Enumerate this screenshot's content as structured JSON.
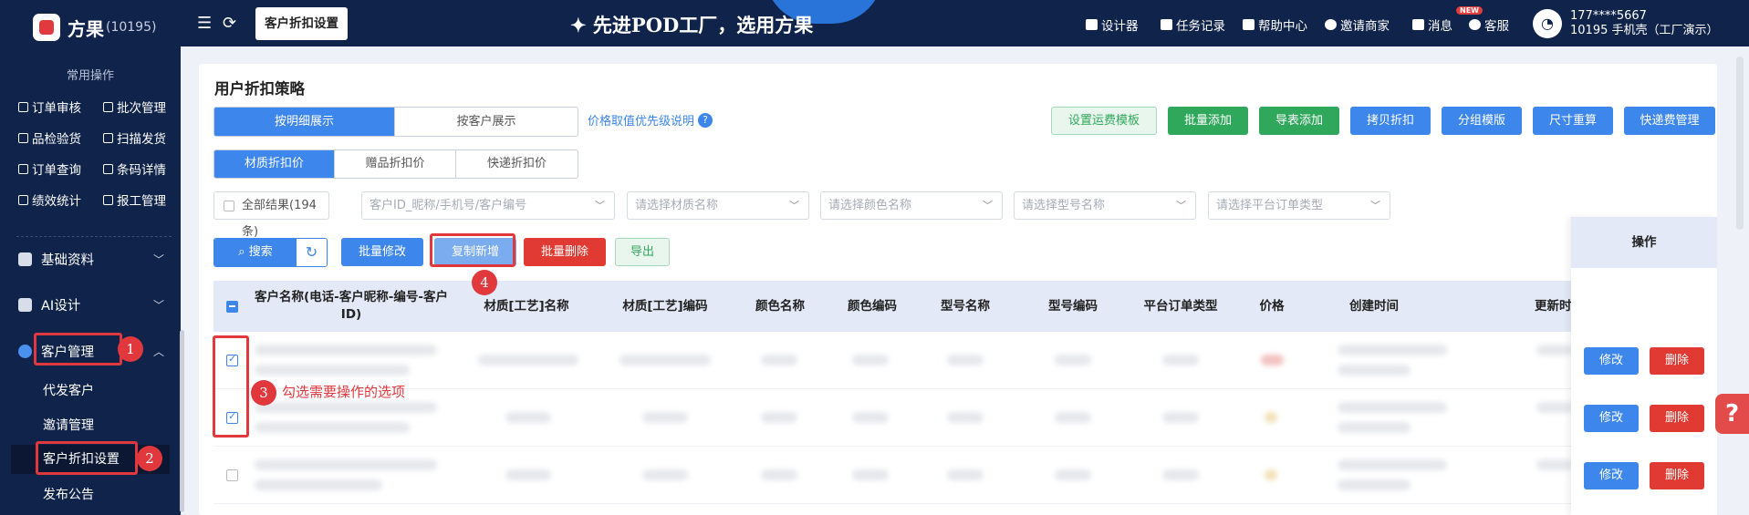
{
  "app": {
    "logo_name": "方果",
    "logo_id": "(10195)"
  },
  "sidebar": {
    "common_title": "常用操作",
    "quick": [
      "订单审核",
      "批次管理",
      "品检验货",
      "扫描发货",
      "订单查询",
      "条码详情",
      "绩效统计",
      "报工管理"
    ],
    "menus": [
      "基础资料",
      "AI设计",
      "客户管理"
    ],
    "subs": [
      "代发客户",
      "邀请管理",
      "客户折扣设置",
      "发布公告"
    ]
  },
  "topbar": {
    "active_tab": "客户折扣设置",
    "slogan": "先进POD工厂，选用方果",
    "links": [
      "设计器",
      "任务记录",
      "帮助中心",
      "邀请商家",
      "消息",
      "客服"
    ],
    "new_badge": "NEW",
    "user_phone": "177****5667",
    "user_org": "10195 手机壳（工厂演示）"
  },
  "page": {
    "title": "用户折扣策略",
    "view_tabs": [
      "按明细展示",
      "按客户展示"
    ],
    "help_link": "价格取值优先级说明",
    "help_q": "?",
    "right_buttons": [
      "设置运费模板",
      "批量添加",
      "导表添加",
      "拷贝折扣",
      "分组模版",
      "尺寸重算",
      "快递费管理"
    ],
    "type_tabs": [
      "材质折扣价",
      "赠品折扣价",
      "快递折扣价"
    ],
    "all_results": "全部结果(194条)",
    "filters": [
      "客户ID_昵称/手机号/客户编号",
      "请选择材质名称",
      "请选择颜色名称",
      "请选择型号名称",
      "请选择平台订单类型"
    ],
    "search": "搜索",
    "actions": [
      "批量修改",
      "复制新增",
      "批量删除",
      "导出"
    ]
  },
  "table": {
    "headers": [
      "客户名称(电话-客户昵称-编号-客户ID)",
      "材质[工艺]名称",
      "材质[工艺]编码",
      "颜色名称",
      "颜色编码",
      "型号名称",
      "型号编码",
      "平台订单类型",
      "价格",
      "创建时间",
      "更新时"
    ],
    "op_header": "操作",
    "edit": "修改",
    "delete": "删除",
    "rows_checked": [
      true,
      true,
      false
    ]
  },
  "annotations": {
    "n1": "1",
    "n2": "2",
    "n3": "3",
    "n4": "4",
    "step3_text": "勾选需要操作的选项"
  },
  "colors": {
    "primary": "#3d86eb",
    "sidebar": "#10234a",
    "annotation": "#e0383c",
    "green": "#30a85c",
    "red": "#e03a33"
  }
}
